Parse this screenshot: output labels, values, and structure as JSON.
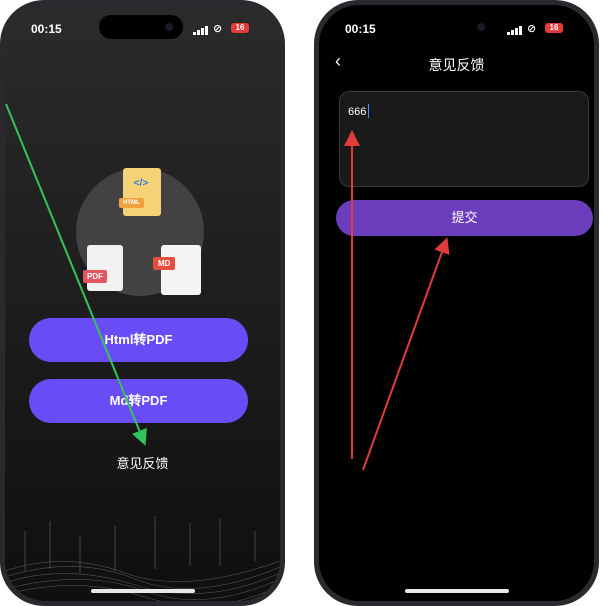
{
  "left_phone": {
    "status_time": "00:15",
    "battery": "16",
    "hero": {
      "html_tag": "HTML",
      "code_glyph": "</>",
      "pdf_tag": "PDF",
      "md_tag": "MD"
    },
    "buttons": {
      "html_to_pdf": "Html转PDF",
      "md_to_pdf": "Md转PDF"
    },
    "feedback_link": "意见反馈"
  },
  "right_phone": {
    "status_time": "00:15",
    "battery": "16",
    "title": "意见反馈",
    "feedback_value": "666",
    "submit": "提交"
  },
  "icons": [
    "location-arrow-icon",
    "signal-icon",
    "link-icon",
    "battery-icon",
    "back-arrow-icon"
  ],
  "colors": {
    "accent_purple": "#6a4cf6",
    "submit_purple": "#6a3dbd",
    "arrow_green": "#33c45a",
    "arrow_red": "#e23b3b"
  }
}
